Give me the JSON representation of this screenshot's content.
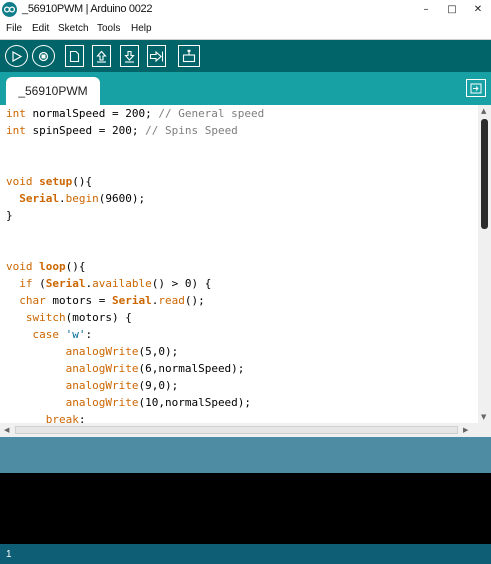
{
  "window": {
    "title": "_56910PWM | Arduino 0022",
    "controls": [
      "–",
      "□",
      "✕"
    ]
  },
  "menu": [
    {
      "label": "File"
    },
    {
      "label": "Edit"
    },
    {
      "label": "Sketch"
    },
    {
      "label": "Tools"
    },
    {
      "label": "Help"
    }
  ],
  "toolbar": {
    "buttons": [
      {
        "name": "verify",
        "icon": "play-icon"
      },
      {
        "name": "stop",
        "icon": "stop-icon"
      },
      {
        "name": "new",
        "icon": "new-file-icon"
      },
      {
        "name": "open",
        "icon": "open-up-arrow-icon"
      },
      {
        "name": "save",
        "icon": "save-down-arrow-icon"
      },
      {
        "name": "upload",
        "icon": "upload-right-arrow-icon"
      },
      {
        "name": "serial-monitor",
        "icon": "serial-monitor-icon"
      }
    ]
  },
  "tab": {
    "label": "_56910PWM"
  },
  "colors": {
    "keyword": "#cc6600",
    "comment": "#7e7e7e",
    "string": "#006699",
    "toolbar": "#006468",
    "tabbar": "#17a1a5"
  },
  "code": [
    {
      "segments": [
        {
          "t": "int",
          "c": "kw"
        },
        {
          "t": " normalSpeed = 200; "
        },
        {
          "t": "// General speed",
          "c": "cm"
        }
      ]
    },
    {
      "segments": [
        {
          "t": "int",
          "c": "kw"
        },
        {
          "t": " spinSpeed = 200; "
        },
        {
          "t": "// Spins Speed",
          "c": "cm"
        }
      ]
    },
    {
      "segments": []
    },
    {
      "segments": []
    },
    {
      "segments": [
        {
          "t": "void",
          "c": "kw"
        },
        {
          "t": " "
        },
        {
          "t": "setup",
          "c": "kwb"
        },
        {
          "t": "(){"
        }
      ]
    },
    {
      "segments": [
        {
          "t": "  "
        },
        {
          "t": "Serial",
          "c": "kwb"
        },
        {
          "t": "."
        },
        {
          "t": "begin",
          "c": "kw"
        },
        {
          "t": "(9600);"
        }
      ]
    },
    {
      "segments": [
        {
          "t": "}"
        }
      ]
    },
    {
      "segments": []
    },
    {
      "segments": []
    },
    {
      "segments": [
        {
          "t": "void",
          "c": "kw"
        },
        {
          "t": " "
        },
        {
          "t": "loop",
          "c": "kwb"
        },
        {
          "t": "(){"
        }
      ]
    },
    {
      "segments": [
        {
          "t": "  "
        },
        {
          "t": "if",
          "c": "kw"
        },
        {
          "t": " ("
        },
        {
          "t": "Serial",
          "c": "kwb"
        },
        {
          "t": "."
        },
        {
          "t": "available",
          "c": "kw"
        },
        {
          "t": "() > 0) {"
        }
      ]
    },
    {
      "segments": [
        {
          "t": "  "
        },
        {
          "t": "char",
          "c": "kw"
        },
        {
          "t": " motors = "
        },
        {
          "t": "Serial",
          "c": "kwb"
        },
        {
          "t": "."
        },
        {
          "t": "read",
          "c": "kw"
        },
        {
          "t": "();"
        }
      ]
    },
    {
      "segments": [
        {
          "t": "   "
        },
        {
          "t": "switch",
          "c": "kw"
        },
        {
          "t": "(motors) {"
        }
      ]
    },
    {
      "segments": [
        {
          "t": "    "
        },
        {
          "t": "case",
          "c": "kw"
        },
        {
          "t": " "
        },
        {
          "t": "'w'",
          "c": "str"
        },
        {
          "t": ":"
        }
      ]
    },
    {
      "segments": [
        {
          "t": "         "
        },
        {
          "t": "analogWrite",
          "c": "kw"
        },
        {
          "t": "(5,0);"
        }
      ]
    },
    {
      "segments": [
        {
          "t": "         "
        },
        {
          "t": "analogWrite",
          "c": "kw"
        },
        {
          "t": "(6,normalSpeed);"
        }
      ]
    },
    {
      "segments": [
        {
          "t": "         "
        },
        {
          "t": "analogWrite",
          "c": "kw"
        },
        {
          "t": "(9,0);"
        }
      ]
    },
    {
      "segments": [
        {
          "t": "         "
        },
        {
          "t": "analogWrite",
          "c": "kw"
        },
        {
          "t": "(10,normalSpeed);"
        }
      ]
    },
    {
      "segments": [
        {
          "t": "      "
        },
        {
          "t": "break",
          "c": "kw"
        },
        {
          "t": ";"
        }
      ]
    }
  ],
  "status": {
    "line_number": "1"
  }
}
